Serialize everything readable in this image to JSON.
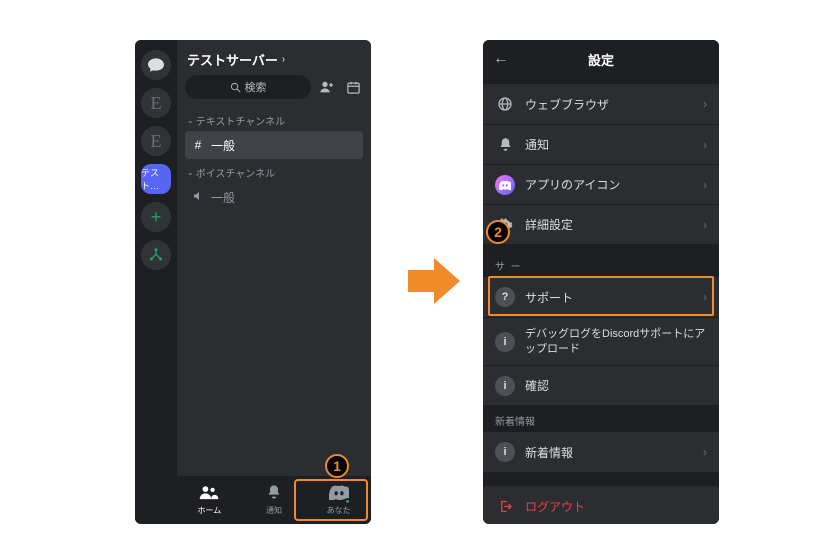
{
  "left": {
    "server_title": "テストサーバー",
    "search_label": "検索",
    "categories": {
      "text": "テキストチャンネル",
      "voice": "ボイスチャンネル"
    },
    "channels": {
      "general": "一般",
      "voice_general": "一般"
    },
    "rail_selected": "テスト…",
    "nav": {
      "home": "ホーム",
      "notify": "通知",
      "you": "あなた"
    }
  },
  "right": {
    "title": "設定",
    "items": {
      "web_browser": "ウェブブラウザ",
      "notifications": "通知",
      "app_icon": "アプリのアイコン",
      "advanced": "詳細設定",
      "support": "サポート",
      "debug_upload": "デバッグログをDiscordサポートにアップロード",
      "confirm": "確認",
      "whats_new_header": "新着情報",
      "whats_new": "新着情報",
      "logout": "ログアウト"
    }
  },
  "badges": {
    "one": "1",
    "two": "2"
  }
}
